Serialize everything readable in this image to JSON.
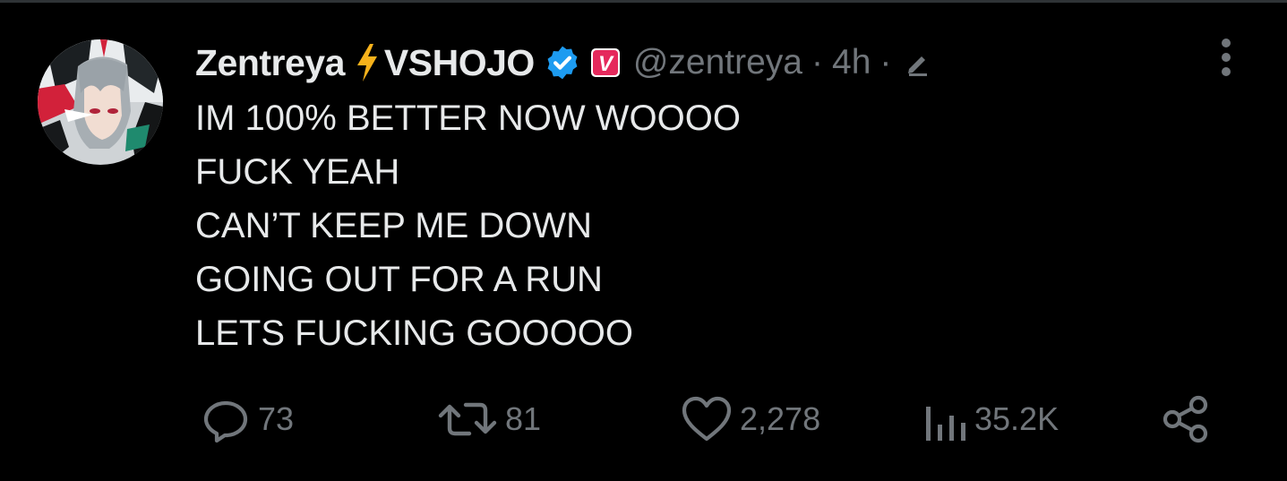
{
  "author": {
    "display_name": "Zentreya",
    "org": "VSHOJO",
    "handle": "@zentreya",
    "badge_letter": "V"
  },
  "meta": {
    "time": "4h",
    "separator": "·"
  },
  "tweet": {
    "lines": [
      "IM 100% BETTER NOW WOOOO",
      "FUCK YEAH",
      "CAN’T KEEP ME DOWN",
      "GOING OUT FOR A RUN",
      "LETS FUCKING GOOOOO"
    ]
  },
  "actions": {
    "replies": "73",
    "retweets": "81",
    "likes": "2,278",
    "views": "35.2K"
  },
  "icons": {
    "bolt": "lightning-bolt-icon",
    "verified": "verified-icon",
    "affiliate": "vshojo-badge-icon",
    "edit": "edited-pencil-icon",
    "more": "more-options-icon",
    "reply": "reply-icon",
    "retweet": "retweet-icon",
    "like": "heart-icon",
    "views": "views-icon",
    "share": "share-icon"
  },
  "colors": {
    "background": "#000000",
    "text": "#e7e9ea",
    "muted": "#71767b",
    "verified_blue": "#1d9bf0",
    "badge_pink": "#e5295c",
    "bolt": "#f7b21b"
  }
}
